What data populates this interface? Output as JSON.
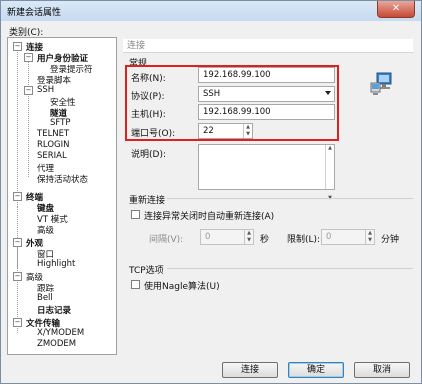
{
  "window": {
    "title": "新建会话属性",
    "close_label": "✕"
  },
  "category_label": "类别(C):",
  "tree": [
    {
      "label": "连接",
      "bold": true
    },
    {
      "label": "用户身份验证",
      "bold": true
    },
    {
      "label": "登录提示符",
      "bold": false
    },
    {
      "label": "登录脚本",
      "bold": false
    },
    {
      "label": "SSH",
      "bold": false
    },
    {
      "label": "安全性",
      "bold": false
    },
    {
      "label": "隧道",
      "bold": true
    },
    {
      "label": "SFTP",
      "bold": false
    },
    {
      "label": "TELNET",
      "bold": false
    },
    {
      "label": "RLOGIN",
      "bold": false
    },
    {
      "label": "SERIAL",
      "bold": false
    },
    {
      "label": "代理",
      "bold": false
    },
    {
      "label": "保持活动状态",
      "bold": false
    },
    {
      "label": "终端",
      "bold": true
    },
    {
      "label": "键盘",
      "bold": true
    },
    {
      "label": "VT 模式",
      "bold": false
    },
    {
      "label": "高级",
      "bold": false
    },
    {
      "label": "外观",
      "bold": true
    },
    {
      "label": "窗口",
      "bold": false
    },
    {
      "label": "Highlight",
      "bold": false
    },
    {
      "label": "高级",
      "bold": false
    },
    {
      "label": "跟踪",
      "bold": false
    },
    {
      "label": "Bell",
      "bold": false
    },
    {
      "label": "日志记录",
      "bold": true
    },
    {
      "label": "文件传输",
      "bold": true
    },
    {
      "label": "X/YMODEM",
      "bold": false
    },
    {
      "label": "ZMODEM",
      "bold": false
    }
  ],
  "section_title": "连接",
  "general": {
    "group_label": "常规",
    "name_label": "名称(N):",
    "name_value": "192.168.99.100",
    "protocol_label": "协议(P):",
    "protocol_value": "SSH",
    "host_label": "主机(H):",
    "host_value": "192.168.99.100",
    "port_label": "端口号(O):",
    "port_value": "22",
    "desc_label": "说明(D):",
    "desc_value": ""
  },
  "reconnect": {
    "group_label": "重新连接",
    "checkbox_label": "连接异常关闭时自动重新连接(A)",
    "interval_label": "间隔(V):",
    "interval_value": "0",
    "interval_unit": "秒",
    "limit_label": "限制(L):",
    "limit_value": "0",
    "limit_unit": "分钟"
  },
  "tcp": {
    "group_label": "TCP选项",
    "nagle_label": "使用Nagle算法(U)"
  },
  "buttons": {
    "connect": "连接",
    "ok": "确定",
    "cancel": "取消"
  },
  "colors": {
    "highlight_box": "#e02020",
    "title_bar": "#c7daf0"
  }
}
